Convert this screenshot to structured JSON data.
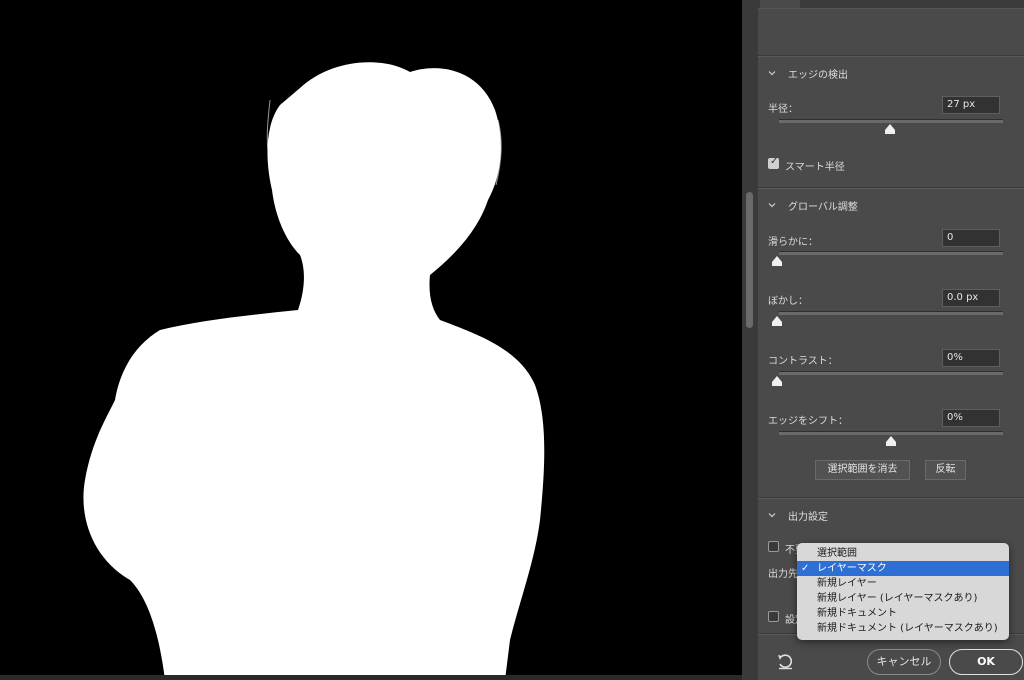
{
  "panel": {
    "edge_detect": {
      "title": "エッジの検出",
      "radius_label": "半径：",
      "radius_value": "27 px",
      "radius_pct": 0.49,
      "smart_radius_label": "スマート半径",
      "smart_radius_checked": true
    },
    "global": {
      "title": "グローバル調整",
      "smooth_label": "滑らかに：",
      "smooth_value": "0",
      "feather_label": "ぼかし：",
      "feather_value": "0.0 px",
      "contrast_label": "コントラスト：",
      "contrast_value": "0%",
      "shift_label": "エッジをシフト：",
      "shift_value": "0%",
      "clear_selection_label": "選択範囲を消去",
      "invert_label": "反転"
    },
    "output": {
      "title": "出力設定",
      "decontaminate_label": "不要",
      "output_to_label": "出力先",
      "remember_label": "設定"
    }
  },
  "popup": {
    "items": [
      {
        "label": "選択範囲"
      },
      {
        "label": "レイヤーマスク"
      },
      {
        "label": "新規レイヤー"
      },
      {
        "label": "新規レイヤー (レイヤーマスクあり)"
      },
      {
        "label": "新規ドキュメント"
      },
      {
        "label": "新規ドキュメント (レイヤーマスクあり)"
      }
    ],
    "selected_index": 1
  },
  "footer": {
    "cancel_label": "キャンセル",
    "ok_label": "OK",
    "reset_icon": "reset-icon"
  },
  "colors": {
    "panel_bg": "#4a4a4a",
    "canvas_bg": "#000000",
    "mask_fg": "#ffffff",
    "menu_highlight": "#2e6fd6"
  }
}
